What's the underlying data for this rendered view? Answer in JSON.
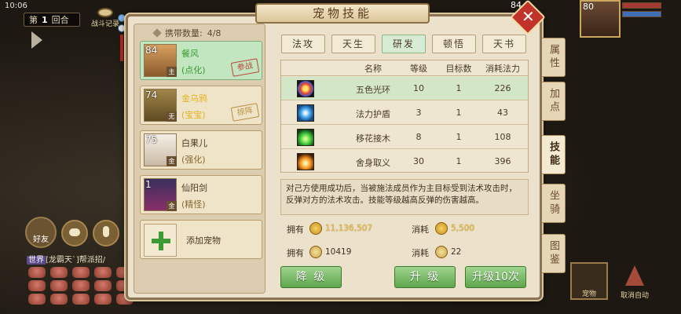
{
  "status_bar": {
    "time": "10:06"
  },
  "hud": {
    "round_label_prefix": "第",
    "round_number": "1",
    "round_label_suffix": "回合",
    "battle_record": "战斗记录",
    "friend_label": "好友",
    "world_chat": {
      "tag": "世界",
      "text": "[龙霸天`]帮派招/"
    },
    "hero_level": "80",
    "enemy_level": "84",
    "guard_label": "宠物",
    "cancel_auto_label": "取消自动"
  },
  "panel": {
    "title": "宠物技能",
    "close_label": "✕",
    "carry_label": "携带数量:",
    "carry_count": "4/8",
    "pets": [
      {
        "level": "84",
        "corner": "主",
        "name": "餐风",
        "sub": "(点化)",
        "stamp": "参战",
        "name_color": "#3b9b30",
        "sub_color": "#3b9b30"
      },
      {
        "level": "74",
        "corner": "无",
        "name": "金乌鸦",
        "sub": "(宝宝)",
        "stamp": "掠阵",
        "name_color": "#e2b21d",
        "sub_color": "#e2b21d"
      },
      {
        "level": "75",
        "corner": "金",
        "name": "白果儿",
        "sub": "(强化)",
        "stamp": "",
        "name_color": "#4a3a26",
        "sub_color": "#8a6a34"
      },
      {
        "level": "1",
        "corner": "金",
        "name": "仙阳剑",
        "sub": "(精怪)",
        "stamp": "",
        "name_color": "#4a3a26",
        "sub_color": "#8a6a34"
      }
    ],
    "add_pet_label": "添加宠物",
    "tabs": [
      "法攻",
      "天生",
      "研发",
      "顿悟",
      "天书"
    ],
    "active_tab": 2,
    "table_headers": {
      "name": "名称",
      "level": "等级",
      "targets": "目标数",
      "cost": "消耗法力"
    },
    "skills": [
      {
        "icon": "rainbow-ring-icon",
        "name": "五色光环",
        "level": "10",
        "targets": "1",
        "cost": "226"
      },
      {
        "icon": "vortex-shield-icon",
        "name": "法力护盾",
        "level": "3",
        "targets": "1",
        "cost": "43"
      },
      {
        "icon": "green-flame-icon",
        "name": "移花接木",
        "level": "8",
        "targets": "1",
        "cost": "108"
      },
      {
        "icon": "sacrifice-fire-icon",
        "name": "舍身取义",
        "level": "30",
        "targets": "1",
        "cost": "396"
      }
    ],
    "selected_skill": 0,
    "description": "对己方使用成功后，当被施法成员作为主目标受到法术攻击时，反弹对方的法术攻击。技能等级越高反弹的伤害越高。",
    "owned_label": "拥有",
    "cost_label": "消耗",
    "owned_coins": "11,136,507",
    "cost_coins": "5,500",
    "owned_points": "10419",
    "cost_points": "22",
    "btn_downgrade": "降 级",
    "btn_upgrade": "升 级",
    "btn_upgrade10": "升级10次",
    "side_tabs": [
      "属性",
      "加点",
      "技能",
      "坐骑",
      "图鉴"
    ],
    "active_side_tab": 2
  }
}
